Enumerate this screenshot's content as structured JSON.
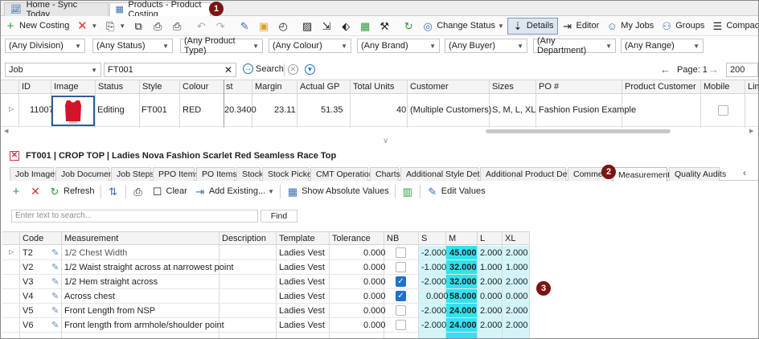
{
  "window_tabs": [
    {
      "label": "Home - Sync Today",
      "icon": "chart-icon"
    },
    {
      "label": "Products - Product Costing",
      "icon": "products-icon"
    }
  ],
  "callouts": [
    "1",
    "2",
    "3"
  ],
  "toolbar": {
    "new_costing": "New Costing",
    "change_status": "Change Status",
    "details": "Details",
    "editor": "Editor",
    "my_jobs": "My Jobs",
    "groups": "Groups",
    "compact": "Compact"
  },
  "filters": [
    "(Any Division)",
    "(Any Status)",
    "(Any Product Type)",
    "(Any Colour)",
    "(Any Brand)",
    "(Any Buyer)",
    "(Any Department)",
    "(Any Range)"
  ],
  "search": {
    "field": "Job",
    "value": "FT001",
    "search_label": "Search",
    "page_label": "Page: 1",
    "page_size": "200"
  },
  "grid": {
    "columns": [
      "ID",
      "Image",
      "Status",
      "Style",
      "Colour",
      "st",
      "Margin",
      "Actual GP",
      "Total Units",
      "Customer",
      "Sizes",
      "PO #",
      "Product Customer",
      "Mobile",
      "Lim"
    ],
    "row": {
      "id": "11007",
      "status": "Editing",
      "style": "FT001",
      "colour": "RED",
      "cost": "20.3400",
      "margin": "23.11",
      "actual_gp": "51.35",
      "total_units": "40",
      "customer": "(Multiple Customers)",
      "sizes": "S, M, L, XL",
      "po": "Fashion Fusion Example"
    }
  },
  "detail": {
    "title": "FT001 | CROP TOP | Ladies Nova Fashion Scarlet Red Seamless Race Top",
    "tabs": [
      "Job Images",
      "Job Documents",
      "Job Steps",
      "PPO Items",
      "PO Items",
      "Stock",
      "Stock Picked",
      "CMT Operations",
      "Charts",
      "Additional Style Details",
      "Additional Product Details",
      "Comments",
      "Measurements",
      "Quality Audits"
    ],
    "active_tab": "Measurements",
    "toolbar": {
      "refresh": "Refresh",
      "clear": "Clear",
      "add_existing": "Add Existing...",
      "show_absolute": "Show Absolute Values",
      "edit_values": "Edit Values"
    },
    "search_placeholder": "Enter text to search...",
    "find_label": "Find"
  },
  "measurements": {
    "columns": [
      "Code",
      "Measurement",
      "Description",
      "Template",
      "Tolerance",
      "NB",
      "S",
      "M",
      "L",
      "XL"
    ],
    "rows": [
      {
        "code": "T2",
        "measurement": "1/2 Chest Width",
        "description": "",
        "template": "Ladies Vest",
        "tolerance": "0.000",
        "nb": false,
        "s": "-2.000",
        "m": "45.000",
        "l": "2.000",
        "xl": "2.000"
      },
      {
        "code": "V2",
        "measurement": "1/2 Waist straight across at narrowest point",
        "description": "",
        "template": "Ladies Vest",
        "tolerance": "0.000",
        "nb": false,
        "s": "-1.000",
        "m": "32.000",
        "l": "1.000",
        "xl": "1.000"
      },
      {
        "code": "V3",
        "measurement": "1/2 Hem straight across",
        "description": "",
        "template": "Ladies Vest",
        "tolerance": "0.000",
        "nb": true,
        "s": "-2.000",
        "m": "32.000",
        "l": "2.000",
        "xl": "2.000"
      },
      {
        "code": "V4",
        "measurement": "Across chest",
        "description": "",
        "template": "Ladies Vest",
        "tolerance": "0.000",
        "nb": true,
        "s": "0.000",
        "m": "58.000",
        "l": "0.000",
        "xl": "0.000"
      },
      {
        "code": "V5",
        "measurement": "Front Length from NSP",
        "description": "",
        "template": "Ladies Vest",
        "tolerance": "0.000",
        "nb": false,
        "s": "-2.000",
        "m": "24.000",
        "l": "2.000",
        "xl": "2.000"
      },
      {
        "code": "V6",
        "measurement": "Front length from armhole/shoulder point",
        "description": "",
        "template": "Ladies Vest",
        "tolerance": "0.000",
        "nb": false,
        "s": "-2.000",
        "m": "24.000",
        "l": "2.000",
        "xl": "2.000"
      }
    ]
  },
  "colors": {
    "accent": "#1e73c7",
    "callout": "#7b1414",
    "m_column": "#33e2f0",
    "size_columns": "#d2f5fa"
  }
}
